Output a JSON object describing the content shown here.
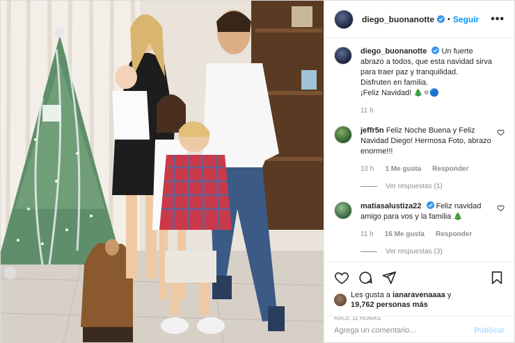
{
  "post": {
    "author": "diego_buonanotte",
    "follow_label": "Seguir",
    "dot": "•",
    "more_label": "•••"
  },
  "caption": {
    "user": "diego_buonanotte",
    "text_line1": "Un fuerte abrazo a todos, que esta navidad sirva para traer paz y tranquilidad.",
    "text_line2": "Disfruten en familia.",
    "text_line3": "¡Feliz Navidad! 🎄⚪🔵",
    "time": "11 h"
  },
  "comments": [
    {
      "user": "jeffr5n",
      "text": "Feliz Noche Buena y Feliz Navidad Diego! Hermosa Foto, abrazo enorme!!!",
      "time": "10 h",
      "likes": "1 Me gusta",
      "reply_label": "Responder",
      "view_replies": "Ver respuestas (1)"
    },
    {
      "user": "matiasalustiza22",
      "text": "Feliz navidad amigo para vos y la familia 🎄",
      "time": "11 h",
      "likes": "16 Me gusta",
      "reply_label": "Responder",
      "view_replies": "Ver respuestas (3)"
    }
  ],
  "likes_block": {
    "prefix": "Les gusta a",
    "liker": "ianaravenaaaa",
    "connector": "y",
    "count": "19,762 personas más"
  },
  "timestamp": "HACE 11 HORAS",
  "composer": {
    "placeholder": "Agrega un comentario...",
    "publish_label": "Publicar"
  },
  "colors": {
    "accent": "#0095f6",
    "publish_disabled": "#b3dbff",
    "muted": "#8e8e8e"
  }
}
